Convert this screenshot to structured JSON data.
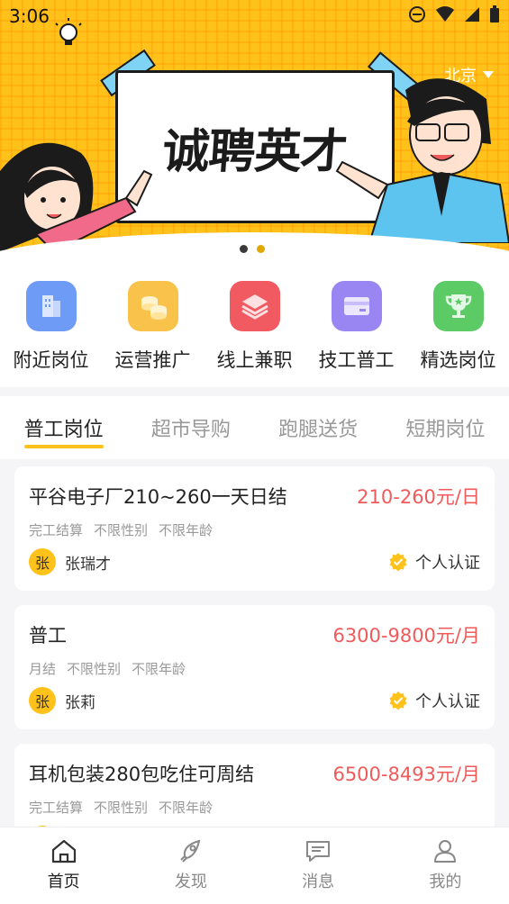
{
  "status_bar": {
    "time": "3:06"
  },
  "banner": {
    "city": "北京",
    "title": "诚聘英才",
    "dots": 2,
    "active_dot": 0
  },
  "categories": [
    {
      "label": "附近岗位",
      "icon": "building-icon",
      "color": "#5b8def"
    },
    {
      "label": "运营推广",
      "icon": "coins-icon",
      "color": "#f7b733"
    },
    {
      "label": "线上兼职",
      "icon": "layers-icon",
      "color": "#f0505a"
    },
    {
      "label": "技工普工",
      "icon": "card-icon",
      "color": "#8f7cf0"
    },
    {
      "label": "精选岗位",
      "icon": "trophy-icon",
      "color": "#4fc65b"
    }
  ],
  "tabs": [
    "普工岗位",
    "超市导购",
    "跑腿送货",
    "短期岗位"
  ],
  "jobs": [
    {
      "title": "平谷电子厂210~260一天日结",
      "salary": "210-260元/日",
      "tags": [
        "完工结算",
        "不限性别",
        "不限年龄"
      ],
      "avatar": "张",
      "poster": "张瑞才",
      "verify": "个人认证"
    },
    {
      "title": "普工",
      "salary": "6300-9800元/月",
      "tags": [
        "月结",
        "不限性别",
        "不限年龄"
      ],
      "avatar": "张",
      "poster": "张莉",
      "verify": "个人认证"
    },
    {
      "title": "耳机包装280包吃住可周结",
      "salary": "6500-8493元/月",
      "tags": [
        "完工结算",
        "不限性别",
        "不限年龄"
      ],
      "avatar": "张",
      "poster": "",
      "verify": ""
    }
  ],
  "bottom_nav": [
    {
      "label": "首页",
      "icon": "home-icon"
    },
    {
      "label": "发现",
      "icon": "rocket-icon"
    },
    {
      "label": "消息",
      "icon": "message-icon"
    },
    {
      "label": "我的",
      "icon": "user-icon"
    }
  ],
  "colors": {
    "accent": "#ffc21a",
    "salary": "#f05a5a"
  }
}
